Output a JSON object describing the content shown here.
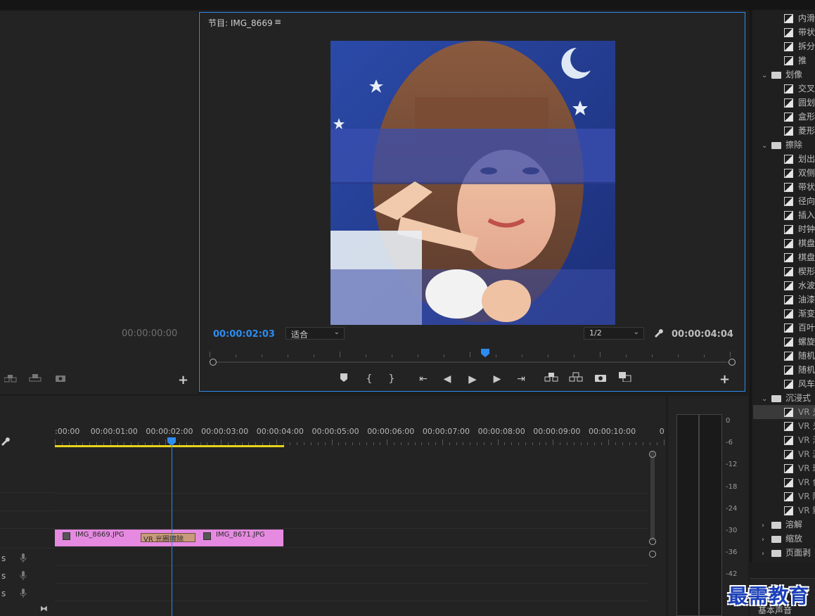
{
  "program_monitor": {
    "title": "节目: IMG_8669",
    "menu_icon": "hamburger-icon",
    "current_time": "00:00:02:03",
    "fit_label": "适合",
    "resolution": "1/2",
    "duration": "00:00:04:04",
    "playhead_fraction": 0.51
  },
  "source_monitor": {
    "timecode": "00:00:00:00"
  },
  "timeline": {
    "ruler_labels": [
      ":00:00",
      "00:00:01:00",
      "00:00:02:00",
      "00:00:03:00",
      "00:00:04:00",
      "00:00:05:00",
      "00:00:06:00",
      "00:00:07:00",
      "00:00:08:00",
      "00:00:09:00",
      "00:00:10:00",
      "0"
    ],
    "clips": [
      {
        "label": "IMG_8669.JPG"
      },
      {
        "label": "IMG_8671.JPG"
      }
    ],
    "transition_label": "VR 光圈擦除",
    "audio_track_labels": [
      "S",
      "S",
      "S"
    ]
  },
  "audio_meter": {
    "db_labels": [
      "0",
      "-6",
      "-12",
      "-18",
      "-24",
      "-30",
      "-36",
      "-42"
    ]
  },
  "effects_tree": [
    {
      "kind": "item",
      "label": "内滑"
    },
    {
      "kind": "item",
      "label": "带状"
    },
    {
      "kind": "item",
      "label": "拆分"
    },
    {
      "kind": "item",
      "label": "推"
    },
    {
      "kind": "folder",
      "label": "划像",
      "open": true
    },
    {
      "kind": "item",
      "label": "交叉"
    },
    {
      "kind": "item",
      "label": "圆划"
    },
    {
      "kind": "item",
      "label": "盒形"
    },
    {
      "kind": "item",
      "label": "菱形"
    },
    {
      "kind": "folder",
      "label": "擦除",
      "open": true
    },
    {
      "kind": "item",
      "label": "划出"
    },
    {
      "kind": "item",
      "label": "双侧"
    },
    {
      "kind": "item",
      "label": "带状"
    },
    {
      "kind": "item",
      "label": "径向"
    },
    {
      "kind": "item",
      "label": "插入"
    },
    {
      "kind": "item",
      "label": "时钟"
    },
    {
      "kind": "item",
      "label": "棋盘"
    },
    {
      "kind": "item",
      "label": "棋盘"
    },
    {
      "kind": "item",
      "label": "楔形"
    },
    {
      "kind": "item",
      "label": "水波"
    },
    {
      "kind": "item",
      "label": "油漆"
    },
    {
      "kind": "item",
      "label": "渐变"
    },
    {
      "kind": "item",
      "label": "百叶"
    },
    {
      "kind": "item",
      "label": "螺旋"
    },
    {
      "kind": "item",
      "label": "随机"
    },
    {
      "kind": "item",
      "label": "随机"
    },
    {
      "kind": "item",
      "label": "风车"
    },
    {
      "kind": "folder",
      "label": "沉浸式",
      "open": true
    },
    {
      "kind": "item",
      "label": "VR 光",
      "selected": true
    },
    {
      "kind": "item",
      "label": "VR 光"
    },
    {
      "kind": "item",
      "label": "VR 渐"
    },
    {
      "kind": "item",
      "label": "VR 漏"
    },
    {
      "kind": "item",
      "label": "VR 球"
    },
    {
      "kind": "item",
      "label": "VR 色"
    },
    {
      "kind": "item",
      "label": "VR 随"
    },
    {
      "kind": "item",
      "label": "VR 默"
    },
    {
      "kind": "folder",
      "label": "溶解",
      "open": false
    },
    {
      "kind": "folder",
      "label": "缩放",
      "open": false
    },
    {
      "kind": "folder",
      "label": "页面剥",
      "open": false
    }
  ],
  "bottom_panel_label": "基本声音",
  "watermark": "最需教育",
  "colors": {
    "accent_blue": "#2d8cf0",
    "clip_pink": "#e58ae0",
    "transition_tan": "#c89a7a",
    "work_area_yellow": "#e8d21a"
  }
}
